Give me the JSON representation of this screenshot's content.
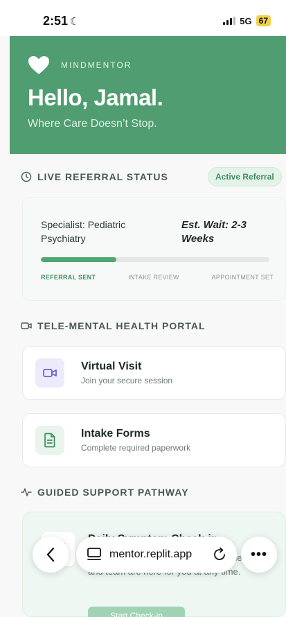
{
  "status_bar": {
    "time": "2:51",
    "network": "5G",
    "battery": "67"
  },
  "hero": {
    "brand": "MINDMENTOR",
    "greeting": "Hello, Jamal.",
    "tagline": "Where Care Doesn’t Stop."
  },
  "referral": {
    "section_title": "LIVE REFERRAL STATUS",
    "badge": "Active Referral",
    "specialist": "Specialist: Pediatric Psychiatry",
    "wait": "Est. Wait: 2-3 Weeks",
    "progress_fraction": 0.33,
    "steps": [
      "REFERRAL SENT",
      "INTAKE REVIEW",
      "APPOINTMENT SET"
    ]
  },
  "portal": {
    "section_title": "TELE-MENTAL HEALTH PORTAL",
    "items": [
      {
        "title": "Virtual Visit",
        "subtitle": "Join your secure session"
      },
      {
        "title": "Intake Forms",
        "subtitle": "Complete required paperwork"
      }
    ]
  },
  "pathway": {
    "section_title": "GUIDED SUPPORT PATHWAY",
    "card_title": "Daily Symptom Check-in",
    "card_desc": "How are things feeling today? Your mentor and team are here for you at any time.",
    "button_label": "Start Check-in"
  },
  "browser": {
    "url": "mentor.replit.app",
    "more_label": "•••"
  },
  "colors": {
    "brand_green": "#4f9d70",
    "accent_green": "#4fa873",
    "video_tile": "#ecebfb",
    "forms_tile": "#e8f4ec"
  }
}
